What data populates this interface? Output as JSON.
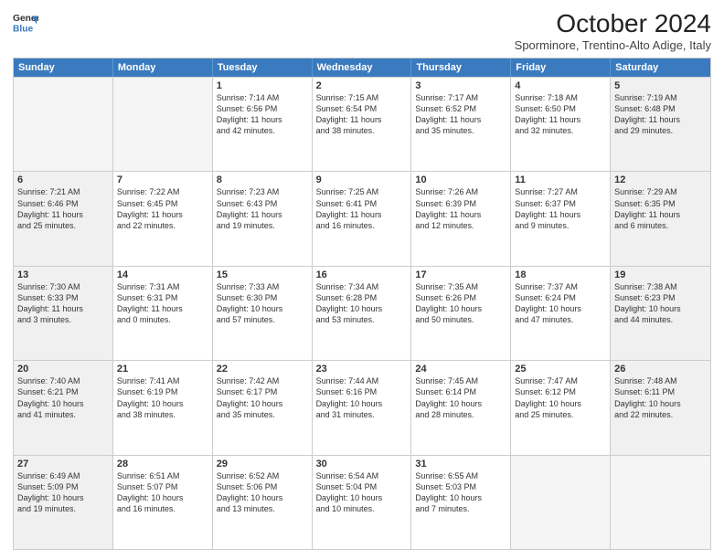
{
  "header": {
    "logo_line1": "General",
    "logo_line2": "Blue",
    "month": "October 2024",
    "location": "Sporminore, Trentino-Alto Adige, Italy"
  },
  "days_of_week": [
    "Sunday",
    "Monday",
    "Tuesday",
    "Wednesday",
    "Thursday",
    "Friday",
    "Saturday"
  ],
  "weeks": [
    [
      {
        "day": "",
        "empty": true
      },
      {
        "day": "",
        "empty": true
      },
      {
        "day": "1",
        "lines": [
          "Sunrise: 7:14 AM",
          "Sunset: 6:56 PM",
          "Daylight: 11 hours",
          "and 42 minutes."
        ]
      },
      {
        "day": "2",
        "lines": [
          "Sunrise: 7:15 AM",
          "Sunset: 6:54 PM",
          "Daylight: 11 hours",
          "and 38 minutes."
        ]
      },
      {
        "day": "3",
        "lines": [
          "Sunrise: 7:17 AM",
          "Sunset: 6:52 PM",
          "Daylight: 11 hours",
          "and 35 minutes."
        ]
      },
      {
        "day": "4",
        "lines": [
          "Sunrise: 7:18 AM",
          "Sunset: 6:50 PM",
          "Daylight: 11 hours",
          "and 32 minutes."
        ]
      },
      {
        "day": "5",
        "lines": [
          "Sunrise: 7:19 AM",
          "Sunset: 6:48 PM",
          "Daylight: 11 hours",
          "and 29 minutes."
        ]
      }
    ],
    [
      {
        "day": "6",
        "lines": [
          "Sunrise: 7:21 AM",
          "Sunset: 6:46 PM",
          "Daylight: 11 hours",
          "and 25 minutes."
        ]
      },
      {
        "day": "7",
        "lines": [
          "Sunrise: 7:22 AM",
          "Sunset: 6:45 PM",
          "Daylight: 11 hours",
          "and 22 minutes."
        ]
      },
      {
        "day": "8",
        "lines": [
          "Sunrise: 7:23 AM",
          "Sunset: 6:43 PM",
          "Daylight: 11 hours",
          "and 19 minutes."
        ]
      },
      {
        "day": "9",
        "lines": [
          "Sunrise: 7:25 AM",
          "Sunset: 6:41 PM",
          "Daylight: 11 hours",
          "and 16 minutes."
        ]
      },
      {
        "day": "10",
        "lines": [
          "Sunrise: 7:26 AM",
          "Sunset: 6:39 PM",
          "Daylight: 11 hours",
          "and 12 minutes."
        ]
      },
      {
        "day": "11",
        "lines": [
          "Sunrise: 7:27 AM",
          "Sunset: 6:37 PM",
          "Daylight: 11 hours",
          "and 9 minutes."
        ]
      },
      {
        "day": "12",
        "lines": [
          "Sunrise: 7:29 AM",
          "Sunset: 6:35 PM",
          "Daylight: 11 hours",
          "and 6 minutes."
        ]
      }
    ],
    [
      {
        "day": "13",
        "lines": [
          "Sunrise: 7:30 AM",
          "Sunset: 6:33 PM",
          "Daylight: 11 hours",
          "and 3 minutes."
        ]
      },
      {
        "day": "14",
        "lines": [
          "Sunrise: 7:31 AM",
          "Sunset: 6:31 PM",
          "Daylight: 11 hours",
          "and 0 minutes."
        ]
      },
      {
        "day": "15",
        "lines": [
          "Sunrise: 7:33 AM",
          "Sunset: 6:30 PM",
          "Daylight: 10 hours",
          "and 57 minutes."
        ]
      },
      {
        "day": "16",
        "lines": [
          "Sunrise: 7:34 AM",
          "Sunset: 6:28 PM",
          "Daylight: 10 hours",
          "and 53 minutes."
        ]
      },
      {
        "day": "17",
        "lines": [
          "Sunrise: 7:35 AM",
          "Sunset: 6:26 PM",
          "Daylight: 10 hours",
          "and 50 minutes."
        ]
      },
      {
        "day": "18",
        "lines": [
          "Sunrise: 7:37 AM",
          "Sunset: 6:24 PM",
          "Daylight: 10 hours",
          "and 47 minutes."
        ]
      },
      {
        "day": "19",
        "lines": [
          "Sunrise: 7:38 AM",
          "Sunset: 6:23 PM",
          "Daylight: 10 hours",
          "and 44 minutes."
        ]
      }
    ],
    [
      {
        "day": "20",
        "lines": [
          "Sunrise: 7:40 AM",
          "Sunset: 6:21 PM",
          "Daylight: 10 hours",
          "and 41 minutes."
        ]
      },
      {
        "day": "21",
        "lines": [
          "Sunrise: 7:41 AM",
          "Sunset: 6:19 PM",
          "Daylight: 10 hours",
          "and 38 minutes."
        ]
      },
      {
        "day": "22",
        "lines": [
          "Sunrise: 7:42 AM",
          "Sunset: 6:17 PM",
          "Daylight: 10 hours",
          "and 35 minutes."
        ]
      },
      {
        "day": "23",
        "lines": [
          "Sunrise: 7:44 AM",
          "Sunset: 6:16 PM",
          "Daylight: 10 hours",
          "and 31 minutes."
        ]
      },
      {
        "day": "24",
        "lines": [
          "Sunrise: 7:45 AM",
          "Sunset: 6:14 PM",
          "Daylight: 10 hours",
          "and 28 minutes."
        ]
      },
      {
        "day": "25",
        "lines": [
          "Sunrise: 7:47 AM",
          "Sunset: 6:12 PM",
          "Daylight: 10 hours",
          "and 25 minutes."
        ]
      },
      {
        "day": "26",
        "lines": [
          "Sunrise: 7:48 AM",
          "Sunset: 6:11 PM",
          "Daylight: 10 hours",
          "and 22 minutes."
        ]
      }
    ],
    [
      {
        "day": "27",
        "lines": [
          "Sunrise: 6:49 AM",
          "Sunset: 5:09 PM",
          "Daylight: 10 hours",
          "and 19 minutes."
        ]
      },
      {
        "day": "28",
        "lines": [
          "Sunrise: 6:51 AM",
          "Sunset: 5:07 PM",
          "Daylight: 10 hours",
          "and 16 minutes."
        ]
      },
      {
        "day": "29",
        "lines": [
          "Sunrise: 6:52 AM",
          "Sunset: 5:06 PM",
          "Daylight: 10 hours",
          "and 13 minutes."
        ]
      },
      {
        "day": "30",
        "lines": [
          "Sunrise: 6:54 AM",
          "Sunset: 5:04 PM",
          "Daylight: 10 hours",
          "and 10 minutes."
        ]
      },
      {
        "day": "31",
        "lines": [
          "Sunrise: 6:55 AM",
          "Sunset: 5:03 PM",
          "Daylight: 10 hours",
          "and 7 minutes."
        ]
      },
      {
        "day": "",
        "empty": true
      },
      {
        "day": "",
        "empty": true
      }
    ]
  ]
}
